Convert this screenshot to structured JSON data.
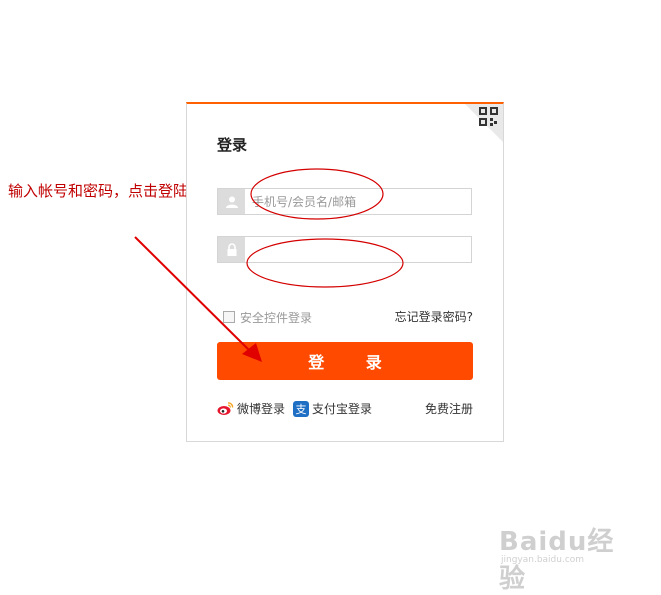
{
  "annotation": {
    "text": "输入帐号和密码，点击登陆",
    "color": "#c00000"
  },
  "login": {
    "title": "登录",
    "qr_icon": "qr-code-icon",
    "username": {
      "icon": "user-icon",
      "placeholder": "手机号/会员名/邮箱",
      "value": ""
    },
    "password": {
      "icon": "lock-icon",
      "placeholder": "",
      "value": ""
    },
    "safe_control_label": "安全控件登录",
    "forgot_password": "忘记登录密码?",
    "submit_label": "登 录",
    "weibo_label": "微博登录",
    "alipay_label": "支付宝登录",
    "register_label": "免费注册",
    "accent_color": "#ff4a00",
    "top_border_color": "#ff6000"
  },
  "watermark": {
    "brand": "Baidu经验",
    "sub": "jingyan.baidu.com"
  }
}
